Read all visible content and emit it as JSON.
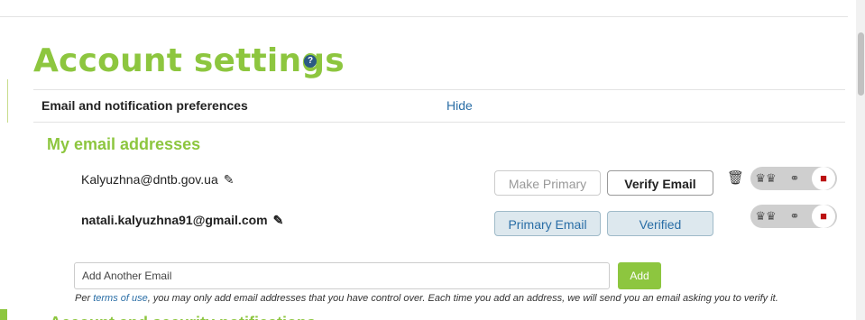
{
  "page": {
    "title": "Account settings",
    "help_icon": "?",
    "accent_color": "#8dc63f",
    "link_color": "#2a6ea6"
  },
  "preferences_row": {
    "label": "Email and notification preferences",
    "toggle": "Hide"
  },
  "emails_section": {
    "title": "My email addresses",
    "items": [
      {
        "address": "Kalyuzhna@dntb.gov.ua",
        "edit_icon": "pencil-icon",
        "primary_button": "Make Primary",
        "verify_button": "Verify Email",
        "delete_icon": "trash-icon",
        "privacy_icons": [
          "people-icon",
          "key-icon",
          "lock-icon"
        ]
      },
      {
        "address": "natali.kalyuzhna91@gmail.com",
        "edit_icon": "pencil-icon",
        "primary_button": "Primary Email",
        "verify_button": "Verified",
        "privacy_icons": [
          "people-icon",
          "key-icon",
          "lock-icon"
        ]
      }
    ]
  },
  "add_email": {
    "placeholder": "Add Another Email",
    "button": "Add",
    "note_prefix": "Per ",
    "note_link": "terms of use",
    "note_suffix": ", you may only add email addresses that you have control over. Each time you add an address, we will send you an email asking you to verify it."
  },
  "next_section": {
    "title": "Account and security notifications"
  }
}
